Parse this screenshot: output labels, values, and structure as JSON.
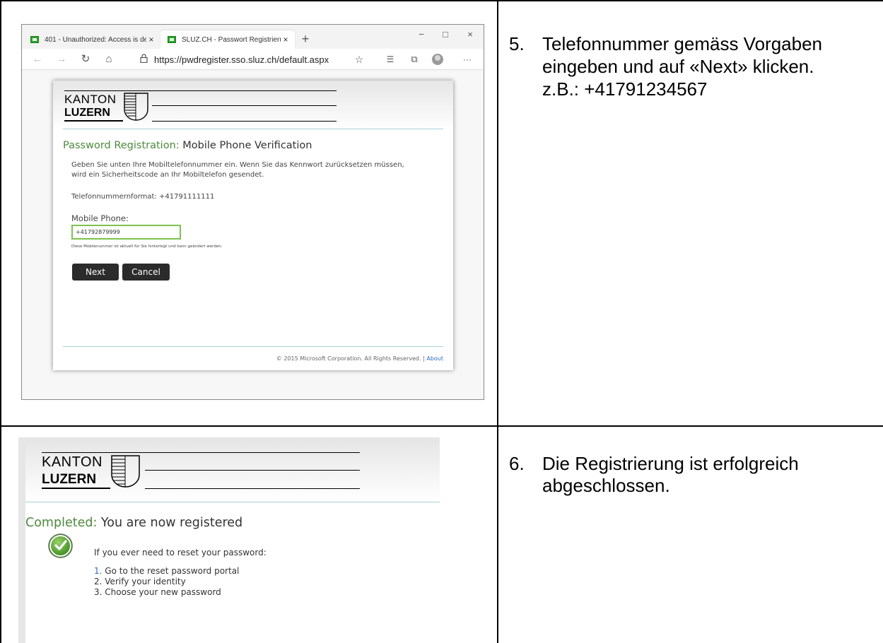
{
  "step5": {
    "number": "5.",
    "lines": [
      "Telefonnummer gemäss Vorgaben",
      "eingeben und auf «Next» klicken.",
      "z.B.: +41791234567"
    ]
  },
  "step6": {
    "number": "6.",
    "lines": [
      "Die Registrierung ist erfolgreich",
      "abgeschlossen."
    ]
  },
  "browser": {
    "tabs": [
      {
        "label": "401 - Unauthorized: Access is de",
        "close": "×"
      },
      {
        "label": "SLUZ.CH - Passwort Registrierun",
        "close": "×"
      }
    ],
    "new_tab": "+",
    "window_controls": {
      "minimize": "−",
      "maximize": "□",
      "close": "×"
    },
    "nav": {
      "back": "←",
      "forward": "→",
      "refresh": "↻",
      "home": "⌂",
      "lock": "🔒",
      "favorite": "☆",
      "favorites_bar": "☰",
      "collections": "⧉",
      "more": "···"
    },
    "url": "https://pwdregister.sso.sluz.ch/default.aspx"
  },
  "logo": {
    "line1": "KANTON",
    "line2": "LUZERN"
  },
  "registration": {
    "title_prefix": "Password Registration:",
    "title_main": "Mobile Phone Verification",
    "intro_line1": "Geben Sie unten Ihre Mobiltelefonnummer ein. Wenn Sie das Kennwort zurücksetzen müssen,",
    "intro_line2": "wird ein Sicherheitscode an Ihr Mobiltelefon gesendet.",
    "format": "Telefonnummernformat: +41791111111",
    "field_label": "Mobile Phone:",
    "field_value": "+41792879999",
    "hint": "Diese Mobilenummer ist aktuell für Sie hinterlegt und kann geändert werden.",
    "next_label": "Next",
    "cancel_label": "Cancel",
    "footer_copyright": "© 2015 Microsoft Corporation. All Rights Reserved.",
    "footer_sep": "|",
    "footer_about": "About"
  },
  "completed": {
    "title_prefix": "Completed:",
    "title_main": "You are now registered",
    "intro": "If you ever need to reset your password:",
    "steps": [
      {
        "num": "1.",
        "text": "Go to the reset password portal"
      },
      {
        "num": "2.",
        "text": "Verify your identity"
      },
      {
        "num": "3.",
        "text": "Choose your new password"
      }
    ]
  },
  "colors": {
    "accent_green": "#4d8a3c",
    "input_border": "#7cc24f",
    "button": "#2b2b2b",
    "link": "#2a6ebb",
    "divider": "#a9d1d9"
  }
}
